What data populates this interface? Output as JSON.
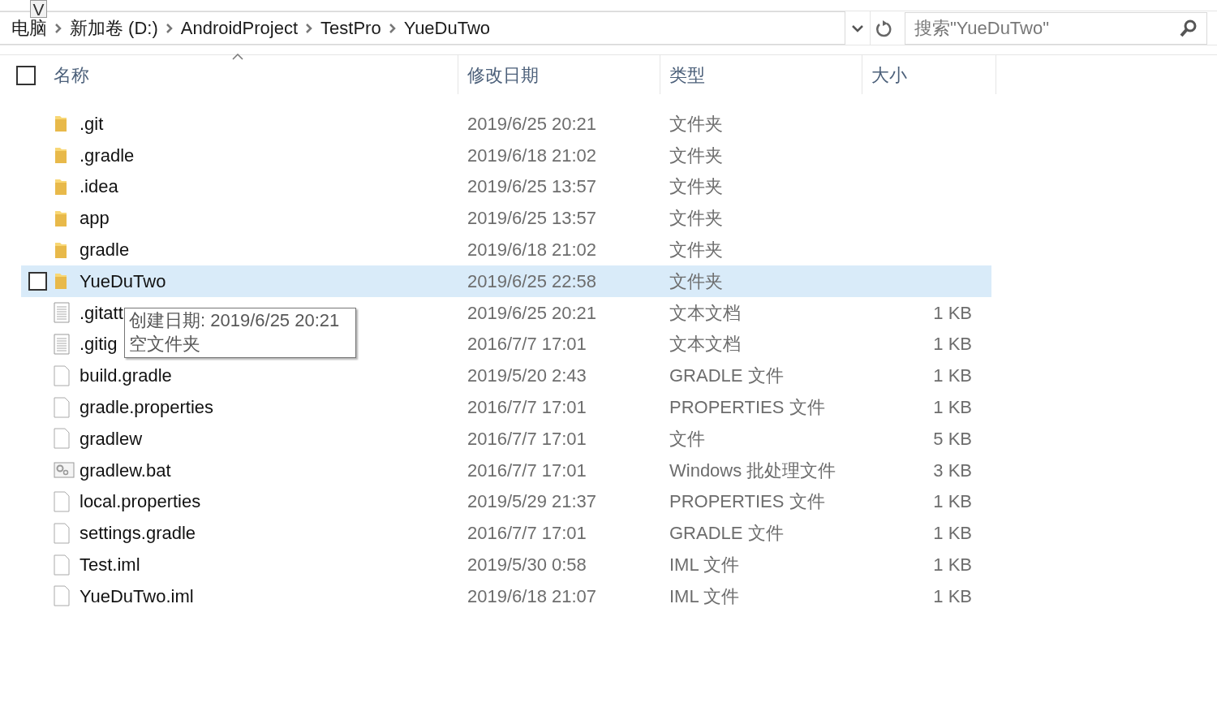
{
  "key_tip": "V",
  "breadcrumb": [
    "电脑",
    "新加卷 (D:)",
    "AndroidProject",
    "TestPro",
    "YueDuTwo"
  ],
  "search": {
    "placeholder": "搜索\"YueDuTwo\""
  },
  "table": {
    "columns": [
      "名称",
      "修改日期",
      "类型",
      "大小"
    ],
    "select_all": {
      "checked": false
    },
    "rows": [
      {
        "kind": "folder",
        "name": ".git",
        "date": "2019/6/25 20:21",
        "type": "文件夹",
        "selected": false
      },
      {
        "kind": "folder",
        "name": ".gradle",
        "date": "2019/6/18 21:02",
        "type": "文件夹",
        "selected": false
      },
      {
        "kind": "folder",
        "name": ".idea",
        "date": "2019/6/25 13:57",
        "type": "文件夹",
        "selected": false
      },
      {
        "kind": "folder",
        "name": "app",
        "date": "2019/6/25 13:57",
        "type": "文件夹",
        "selected": false
      },
      {
        "kind": "folder",
        "name": "gradle",
        "date": "2019/6/18 21:02",
        "type": "文件夹",
        "selected": false
      },
      {
        "kind": "folder",
        "name": "YueDuTwo",
        "date": "2019/6/25 22:58",
        "type": "文件夹",
        "selected": true
      },
      {
        "kind": "text",
        "name": ".gitatt",
        "date": "2019/6/25 20:21",
        "type": "文本文档",
        "size": "1 KB",
        "selected": false
      },
      {
        "kind": "text",
        "name": ".gitig",
        "date": "2016/7/7 17:01",
        "type": "文本文档",
        "size": "1 KB",
        "selected": false
      },
      {
        "kind": "file",
        "name": "build.gradle",
        "date": "2019/5/20 2:43",
        "type": "GRADLE 文件",
        "size": "1 KB",
        "selected": false
      },
      {
        "kind": "file",
        "name": "gradle.properties",
        "date": "2016/7/7 17:01",
        "type": "PROPERTIES 文件",
        "size": "1 KB",
        "selected": false
      },
      {
        "kind": "file",
        "name": "gradlew",
        "date": "2016/7/7 17:01",
        "type": "文件",
        "size": "5 KB",
        "selected": false
      },
      {
        "kind": "bat",
        "name": "gradlew.bat",
        "date": "2016/7/7 17:01",
        "type": "Windows 批处理文件",
        "size": "3 KB",
        "selected": false
      },
      {
        "kind": "file",
        "name": "local.properties",
        "date": "2019/5/29 21:37",
        "type": "PROPERTIES 文件",
        "size": "1 KB",
        "selected": false
      },
      {
        "kind": "file",
        "name": "settings.gradle",
        "date": "2016/7/7 17:01",
        "type": "GRADLE 文件",
        "size": "1 KB",
        "selected": false
      },
      {
        "kind": "file",
        "name": "Test.iml",
        "date": "2019/5/30 0:58",
        "type": "IML 文件",
        "size": "1 KB",
        "selected": false
      },
      {
        "kind": "file",
        "name": "YueDuTwo.iml",
        "date": "2019/6/18 21:07",
        "type": "IML 文件",
        "size": "1 KB",
        "selected": false
      }
    ]
  },
  "tooltip": [
    "创建日期: 2019/6/25 20:21",
    "空文件夹"
  ]
}
